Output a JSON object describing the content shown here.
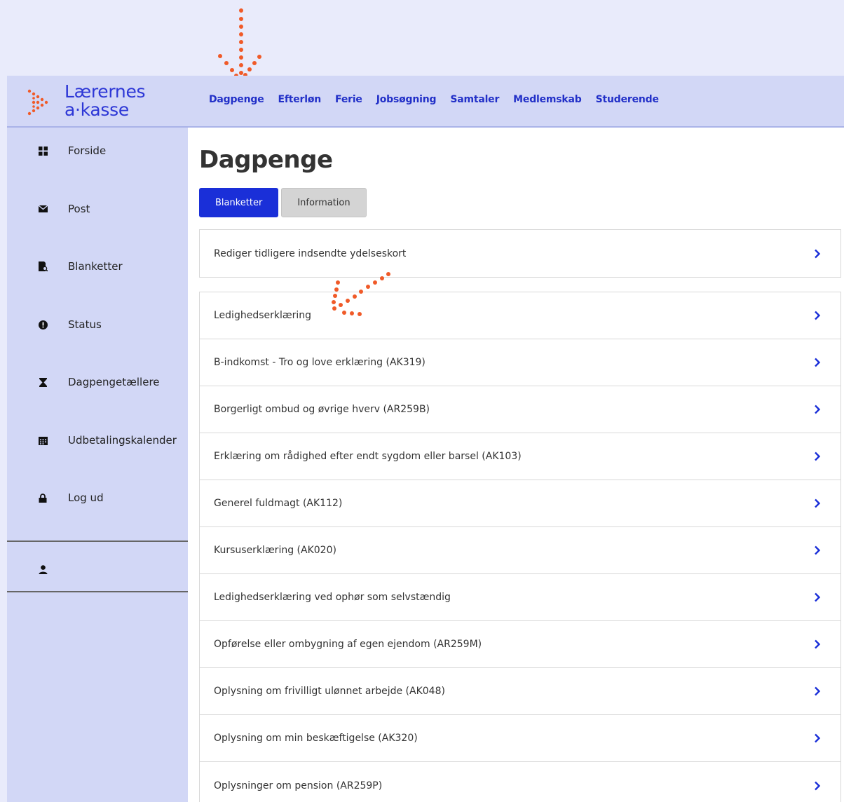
{
  "logo": {
    "line1": "Lærernes",
    "line2": "a·kasse"
  },
  "nav": [
    {
      "label": "Dagpenge"
    },
    {
      "label": "Efterløn"
    },
    {
      "label": "Ferie"
    },
    {
      "label": "Jobsøgning"
    },
    {
      "label": "Samtaler"
    },
    {
      "label": "Medlemskab"
    },
    {
      "label": "Studerende"
    }
  ],
  "sidebar": {
    "items": [
      {
        "label": "Forside",
        "icon": "grid-icon"
      },
      {
        "label": "Post",
        "icon": "envelope-icon"
      },
      {
        "label": "Blanketter",
        "icon": "document-search-icon"
      },
      {
        "label": "Status",
        "icon": "exclamation-icon"
      },
      {
        "label": "Dagpengetællere",
        "icon": "hourglass-icon"
      },
      {
        "label": "Udbetalingskalender",
        "icon": "calendar-icon"
      },
      {
        "label": "Log ud",
        "icon": "lock-icon"
      }
    ],
    "profile_icon": "user-icon"
  },
  "page": {
    "title": "Dagpenge",
    "tabs": [
      {
        "label": "Blanketter",
        "active": true
      },
      {
        "label": "Information",
        "active": false
      }
    ],
    "top_card": {
      "label": "Rediger tidligere indsendte ydelseskort"
    },
    "forms": [
      "Ledighedserklæring",
      "B-indkomst - Tro og love erklæring (AK319)",
      "Borgerligt ombud og øvrige hverv (AR259B)",
      "Erklæring om rådighed efter endt sygdom eller barsel (AK103)",
      "Generel fuldmagt (AK112)",
      "Kursuserklæring (AK020)",
      "Ledighedserklæring ved ophør som selvstændig",
      "Opførelse eller ombygning af egen ejendom (AR259M)",
      "Oplysning om frivilligt ulønnet arbejde (AK048)",
      "Oplysning om min beskæftigelse (AK320)",
      "Oplysninger om pension (AR259P)"
    ]
  },
  "colors": {
    "accent": "#1a2fd8",
    "nav_bg": "#d2d7f6",
    "annotation": "#f05a28"
  }
}
